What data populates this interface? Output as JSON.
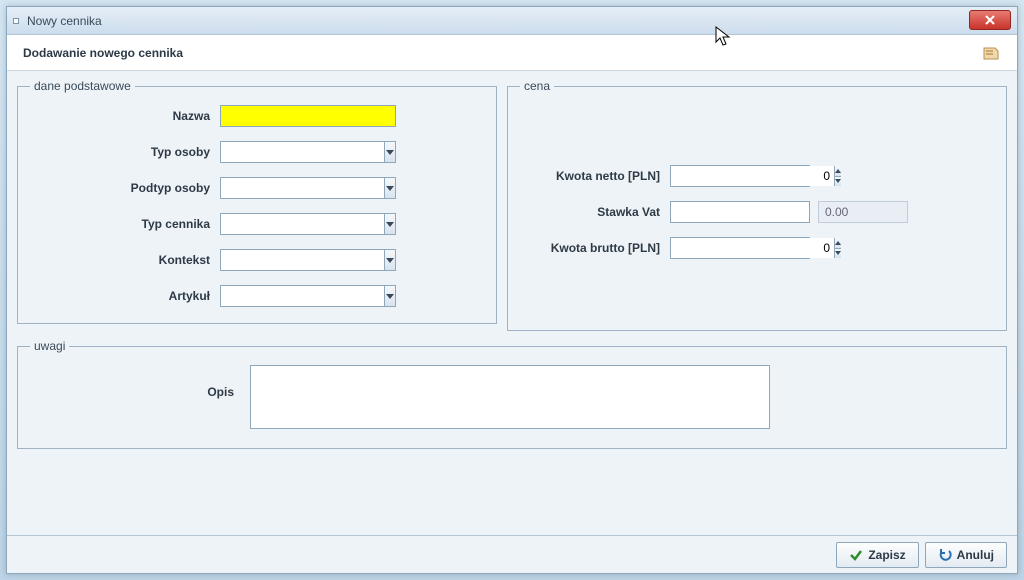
{
  "window": {
    "title": "Nowy cennika",
    "subtitle": "Dodawanie nowego cennika"
  },
  "groups": {
    "basic": "dane podstawowe",
    "price": "cena",
    "notes": "uwagi"
  },
  "labels": {
    "nazwa": "Nazwa",
    "typ_osoby": "Typ osoby",
    "podtyp_osoby": "Podtyp osoby",
    "typ_cennika": "Typ cennika",
    "kontekst": "Kontekst",
    "artykul": "Artykuł",
    "kwota_netto": "Kwota netto [PLN]",
    "stawka_vat": "Stawka Vat",
    "kwota_brutto": "Kwota brutto [PLN]",
    "opis": "Opis"
  },
  "values": {
    "nazwa": "",
    "typ_osoby": "",
    "podtyp_osoby": "",
    "typ_cennika": "",
    "kontekst": "",
    "artykul": "",
    "kwota_netto": "0",
    "stawka_vat": "",
    "vat_display": "0.00",
    "kwota_brutto": "0",
    "opis": ""
  },
  "buttons": {
    "save": "Zapisz",
    "cancel": "Anuluj"
  }
}
